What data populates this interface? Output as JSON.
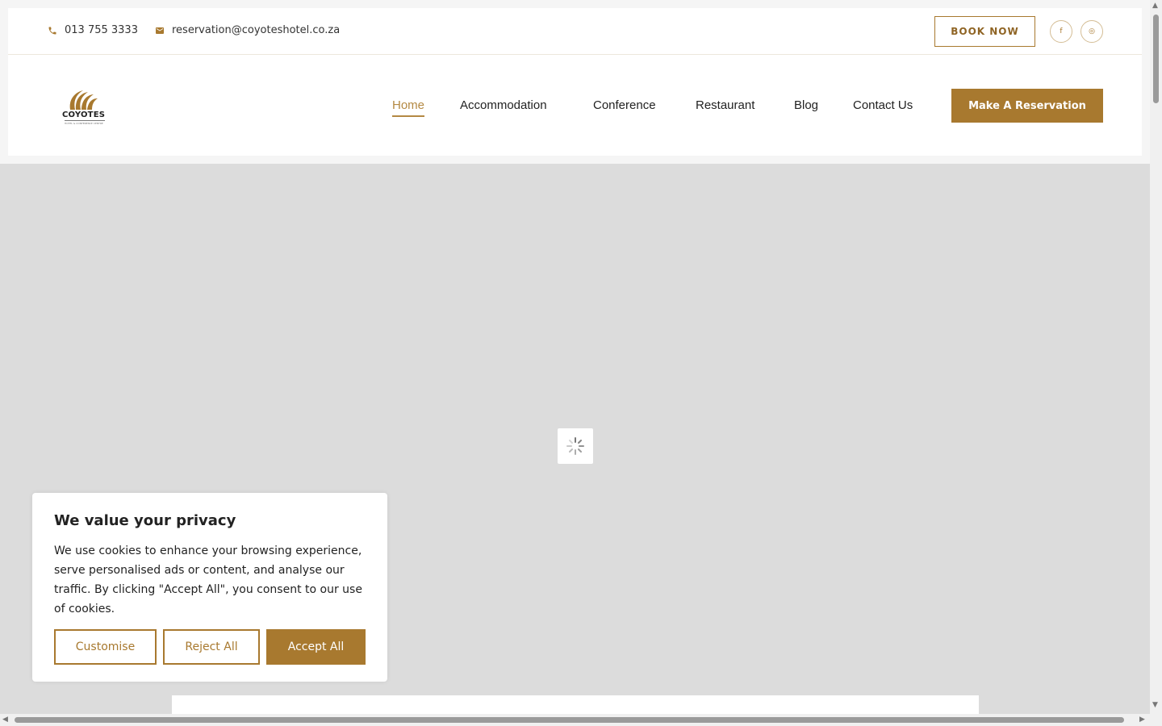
{
  "topbar": {
    "phone": "013 755 3333",
    "email": "reservation@coyoteshotel.co.za",
    "book_now": "BOOK NOW",
    "facebook_icon": "f",
    "instagram_icon": "◎"
  },
  "logo": {
    "name": "COYOTES",
    "sub": "HOTEL & CONFERENCE CENTRE"
  },
  "nav": {
    "items": [
      "Home",
      "Accommodation",
      "Conference",
      "Restaurant",
      "Blog",
      "Contact Us"
    ],
    "reserve": "Make A Reservation"
  },
  "cookie": {
    "title": "We value your privacy",
    "body": "We use cookies to enhance your browsing experience, serve personalised ads or content, and analyse our traffic. By clicking \"Accept All\", you consent to our use of cookies.",
    "customise": "Customise",
    "reject": "Reject All",
    "accept": "Accept All"
  },
  "colors": {
    "accent": "#a8792f",
    "active_nav": "#b48943"
  }
}
